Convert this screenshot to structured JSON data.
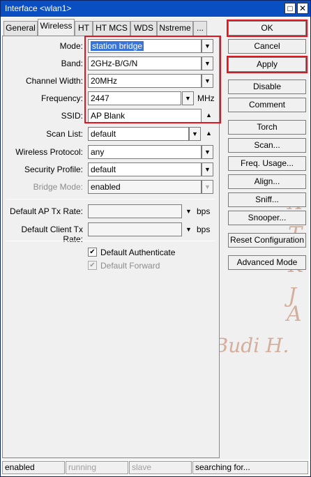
{
  "window": {
    "title": "Interface <wlan1>",
    "maximize": "□",
    "close": "✕"
  },
  "tabs": [
    "General",
    "Wireless",
    "HT",
    "HT MCS",
    "WDS",
    "Nstreme",
    "..."
  ],
  "form": {
    "mode_label": "Mode:",
    "mode_value": "station bridge",
    "band_label": "Band:",
    "band_value": "2GHz-B/G/N",
    "width_label": "Channel Width:",
    "width_value": "20MHz",
    "freq_label": "Frequency:",
    "freq_value": "2447",
    "freq_unit": "MHz",
    "ssid_label": "SSID:",
    "ssid_value": "AP Blank",
    "scan_label": "Scan List:",
    "scan_value": "default",
    "proto_label": "Wireless Protocol:",
    "proto_value": "any",
    "sec_label": "Security Profile:",
    "sec_value": "default",
    "bridge_label": "Bridge Mode:",
    "bridge_value": "enabled",
    "aptx_label": "Default AP Tx Rate:",
    "aptx_unit": "bps",
    "clitx_label": "Default Client Tx Rate:",
    "clitx_unit": "bps",
    "auth_label": "Default Authenticate",
    "fwd_label": "Default Forward"
  },
  "buttons": {
    "ok": "OK",
    "cancel": "Cancel",
    "apply": "Apply",
    "disable": "Disable",
    "comment": "Comment",
    "torch": "Torch",
    "scan": "Scan...",
    "freq_usage": "Freq. Usage...",
    "align": "Align...",
    "sniff": "Sniff...",
    "snooper": "Snooper...",
    "reset": "Reset Configuration",
    "advanced": "Advanced Mode"
  },
  "status": [
    "enabled",
    "running",
    "slave",
    "searching for..."
  ],
  "watermark": {
    "name": "Rian Budi H.",
    "letters": [
      "X",
      "T",
      "K",
      "J",
      "A"
    ]
  },
  "colors": {
    "highlight": "#e8121d",
    "selection": "#3875d7",
    "titlebar": "#0a4fc1"
  }
}
